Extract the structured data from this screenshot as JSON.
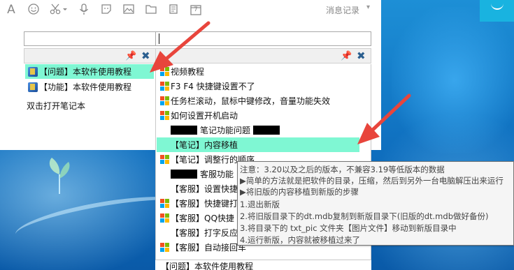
{
  "toolbar": {
    "icons": [
      "font-icon",
      "emoji-icon",
      "scissors-icon",
      "microphone-icon",
      "sticker-icon",
      "image-icon",
      "folder-icon",
      "note-icon",
      "calendar-icon"
    ],
    "font_glyph": "A",
    "calendar_glyph": "7",
    "history_label": "消息记录",
    "history_arrow": "▾"
  },
  "left_panel": {
    "search_value": "",
    "items": [
      {
        "label": "【问题】本软件使用教程",
        "selected": true
      },
      {
        "label": "【功能】本软件使用教程",
        "selected": false
      }
    ],
    "hint": "双击打开笔记本"
  },
  "right_panel": {
    "search_value": "",
    "items": [
      {
        "label": "视频教程",
        "icon": true
      },
      {
        "label": "F3 F4 快捷键设置不了",
        "icon": true
      },
      {
        "label": "任务栏滚动，鼠标中键修改，音量功能失效",
        "icon": true
      },
      {
        "label": "如何设置开机启动",
        "icon": true
      },
      {
        "label": "笔记功能问题",
        "icon": false,
        "redacted_before": true,
        "redacted_after": true
      },
      {
        "label": "【笔记】内容移植",
        "icon": false,
        "selected": true
      },
      {
        "label": "【笔记】调整行的顺序",
        "icon": true
      },
      {
        "label": "客服功能",
        "icon": false,
        "redacted_before": true
      },
      {
        "label": "【客服】设置快捷",
        "icon": false
      },
      {
        "label": "【客服】快捷键打",
        "icon": true
      },
      {
        "label": "【客服】QQ快捷",
        "icon": true
      },
      {
        "label": "【客服】打字反应",
        "icon": false
      },
      {
        "label": "【客服】自动接回车",
        "icon": true
      }
    ],
    "bottom_label": "【问题】本软件使用教程"
  },
  "tooltip": {
    "lines": [
      "注意：3.20以及之后的版本，不兼容3.19等低版本的数据",
      "▶简单的方法就是把软件的目录，压缩，然后到另外一台电脑解压出来运行",
      "▶将旧版的内容移植到新版的步骤",
      "1.退出新版",
      "2.将旧版目录下的dt.mdb复制到新版目录下(旧版的dt.mdb做好备份)",
      "3.将目录下的 txt_pic 文件夹【图片文件】移动到新版目录中",
      "4.运行新版，内容就被移植过来了"
    ]
  },
  "colors": {
    "selection": "#7ff7d3",
    "arrow": "#e8453c",
    "desktop": "#1d8fd6",
    "accent": "#19b3e0"
  }
}
